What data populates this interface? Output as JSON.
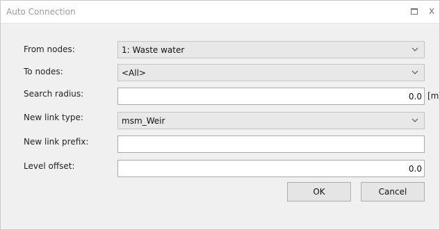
{
  "window": {
    "title": "Auto Connection",
    "maximize_icon": "maximize-icon",
    "close_label": "x"
  },
  "form": {
    "from_nodes": {
      "label": "From nodes:",
      "value": "1: Waste water"
    },
    "to_nodes": {
      "label": "To nodes:",
      "value": "<All>"
    },
    "search_radius": {
      "label": "Search radius:",
      "value": "0.0",
      "unit": "[m]"
    },
    "new_link_type": {
      "label": "New link type:",
      "value": "msm_Weir"
    },
    "new_link_prefix": {
      "label": "New link prefix:",
      "value": ""
    },
    "level_offset": {
      "label": "Level offset:",
      "value": "0.0"
    }
  },
  "buttons": {
    "ok": "OK",
    "cancel": "Cancel"
  },
  "icons": {
    "dropdown": "chevron-down-icon"
  },
  "colors": {
    "combo_bg": "#e8e8e8",
    "text_bg": "#ffffff",
    "window_bg": "#f0f0f0",
    "title_text": "#9a9a9a"
  }
}
